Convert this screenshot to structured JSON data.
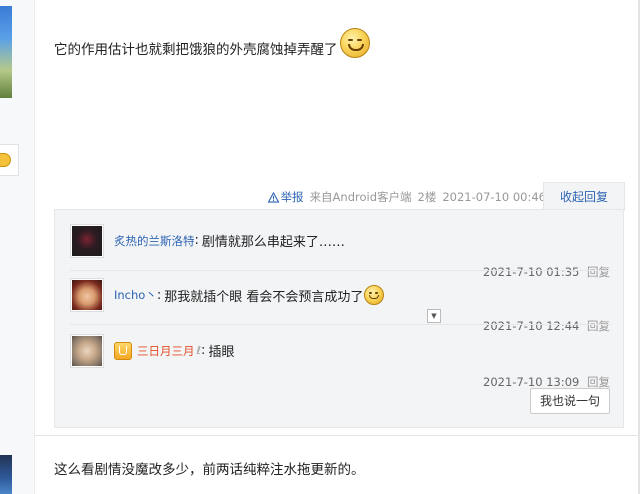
{
  "post": {
    "content": "它的作用估计也就剩把饿狼的外壳腐蚀掉弄醒了",
    "emoji_icon": "smile-emoji",
    "meta": {
      "report_label": "举报",
      "source": "来自Android客户端",
      "floor": "2楼",
      "datetime": "2021-07-10 00:46"
    },
    "collapse_label": "收起回复"
  },
  "replies": [
    {
      "user": "炙热的兰斯洛特",
      "sep": ":",
      "text": "剧情就那么串起来了……",
      "time": "2021-7-10 01:35",
      "reply_label": "回复"
    },
    {
      "user": "Incho丶",
      "sep": ":",
      "text": "那我就插个眼 看会不会预言成功了",
      "time": "2021-7-10 12:44",
      "reply_label": "回复"
    },
    {
      "user": "三日月三月",
      "suffix": "ℓ",
      "sep": ":",
      "text": "插眼",
      "time": "2021-7-10 13:09",
      "reply_label": "回复"
    }
  ],
  "reply_button_label": "我也说一句",
  "next_post": {
    "content": "这么看剧情没魔改多少，前两话纯粹注水拖更新的。"
  },
  "colors": {
    "link": "#2d64b3",
    "vip_name": "#e54d26",
    "reply_bg": "#f3f4f6"
  }
}
